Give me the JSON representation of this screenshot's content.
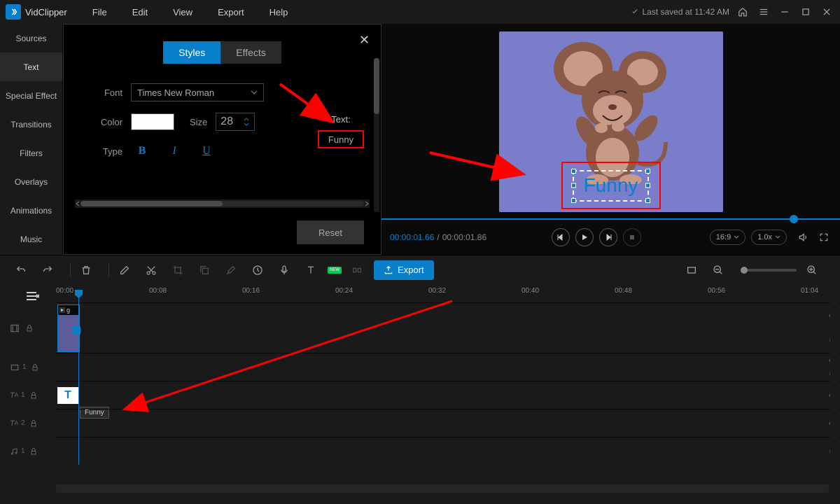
{
  "app": {
    "name": "VidClipper",
    "save_status": "Last saved at 11:42 AM"
  },
  "menu": {
    "file": "File",
    "edit": "Edit",
    "view": "View",
    "export": "Export",
    "help": "Help"
  },
  "sidebar": {
    "items": [
      {
        "label": "Sources"
      },
      {
        "label": "Text"
      },
      {
        "label": "Special Effect"
      },
      {
        "label": "Transitions"
      },
      {
        "label": "Filters"
      },
      {
        "label": "Overlays"
      },
      {
        "label": "Animations"
      },
      {
        "label": "Music"
      }
    ]
  },
  "panel": {
    "tabs": {
      "styles": "Styles",
      "effects": "Effects"
    },
    "font_label": "Font",
    "font_value": "Times New Roman",
    "color_label": "Color",
    "color_value": "#ffffff",
    "size_label": "Size",
    "size_value": "28",
    "type_label": "Type",
    "type_bold": "B",
    "type_italic": "I",
    "type_underline": "U",
    "text_label": "Text:",
    "text_value": "Funny",
    "reset": "Reset"
  },
  "preview": {
    "overlay_text": "Funny",
    "time_current": "00:00:01.66",
    "time_total": "00:00:01.86",
    "aspect": "16:9",
    "speed": "1.0x"
  },
  "toolbar": {
    "export": "Export",
    "new": "NEW"
  },
  "timeline": {
    "ticks": [
      "00:00",
      "00:08",
      "00:16",
      "00:24",
      "00:32",
      "00:40",
      "00:48",
      "00:56",
      "01:04"
    ],
    "video_clip_label": "g",
    "text_clip_glyph": "T",
    "text_clip_tooltip": "Funny",
    "track_labels": {
      "t1": "1",
      "ta1": "1",
      "ta2": "2",
      "m1": "1"
    }
  }
}
